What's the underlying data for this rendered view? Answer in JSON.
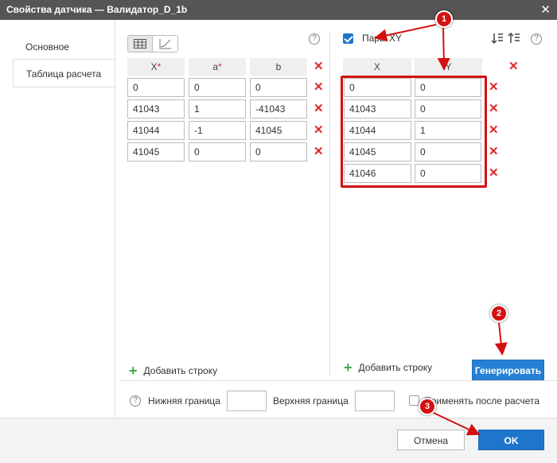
{
  "window": {
    "title": "Свойства датчика — Валидатор_D_1b",
    "close_glyph": "✕"
  },
  "tabs": [
    {
      "label": "Основное",
      "active": false
    },
    {
      "label": "Таблица расчета",
      "active": true
    }
  ],
  "left_table": {
    "view_toggle": [
      "table-icon",
      "chart-icon"
    ],
    "selected_view": "table",
    "help": "?",
    "columns": [
      {
        "label": "X",
        "required": true
      },
      {
        "label": "a",
        "required": true
      },
      {
        "label": "b",
        "required": false
      }
    ],
    "required_mark": "*",
    "rows": [
      [
        "0",
        "0",
        "0"
      ],
      [
        "41043",
        "1",
        "-41043"
      ],
      [
        "41044",
        "-1",
        "41045"
      ],
      [
        "41045",
        "0",
        "0"
      ]
    ],
    "delete_glyph": "✕",
    "add_row_plus": "+",
    "add_row_label": "Добавить строку"
  },
  "right_table": {
    "pairs_checkbox": {
      "label": "Пары XY",
      "checked": true
    },
    "columns": [
      {
        "label": "X"
      },
      {
        "label": "Y"
      }
    ],
    "rows": [
      [
        "0",
        "0"
      ],
      [
        "41043",
        "0"
      ],
      [
        "41044",
        "1"
      ],
      [
        "41045",
        "0"
      ],
      [
        "41046",
        "0"
      ]
    ],
    "delete_glyph": "✕",
    "add_row_plus": "+",
    "add_row_label": "Добавить строку",
    "generate_button": "Генерировать",
    "sort_icons": [
      "sort-ascending-icon",
      "sort-descending-icon"
    ]
  },
  "bounds": {
    "help": "?",
    "lower_label": "Нижняя граница",
    "lower_value": "",
    "upper_label": "Верхняя граница",
    "upper_value": "",
    "apply_after_label": "Применять после расчета",
    "apply_after_checked": false
  },
  "footer": {
    "cancel_label": "Отмена",
    "ok_label": "OK"
  },
  "annotations": {
    "markers": [
      "1",
      "2",
      "3"
    ],
    "color": "#d41010"
  },
  "colors": {
    "accent": "#1f75c9",
    "delete": "#e0292a",
    "add": "#46a546",
    "title_bar": "#555555"
  }
}
